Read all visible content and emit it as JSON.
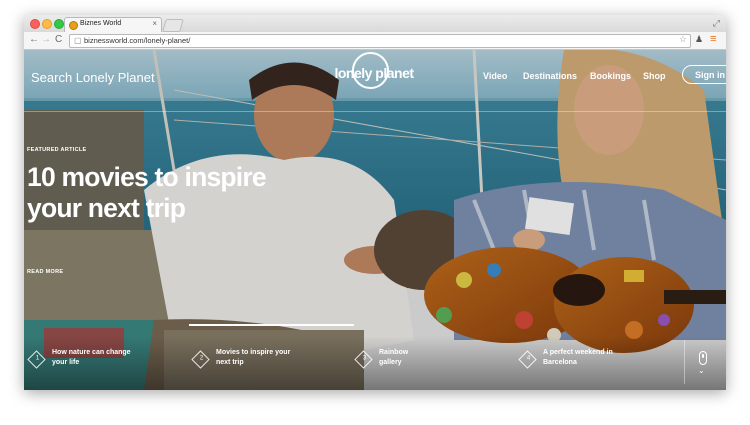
{
  "browser": {
    "tab_title": "Biznes World",
    "tab_close": "×",
    "url": "biznessworld.com/lonely-planet/",
    "back_glyph": "←",
    "forward_glyph": "→",
    "reload_glyph": "C",
    "star_glyph": "☆",
    "menu_glyph": "≡",
    "resize_glyph": "⤢"
  },
  "site": {
    "search_placeholder": "Search Lonely Planet",
    "logo_text": "lonely planet",
    "nav": [
      "Video",
      "Destinations",
      "Bookings",
      "Shop"
    ],
    "signin_label": "Sign in"
  },
  "hero": {
    "kicker": "FEATURED ARTICLE",
    "headline_line1": "10 movies to inspire",
    "headline_line2": "your next trip",
    "read_more": "READ MORE",
    "progress_fraction": 0.25
  },
  "carousel": [
    {
      "num": "1",
      "line1": "How nature can change",
      "line2": "your life"
    },
    {
      "num": "2",
      "line1": "Movies to inspire your",
      "line2": "next trip"
    },
    {
      "num": "3",
      "line1": "Rainbow",
      "line2": "gallery"
    },
    {
      "num": "4",
      "line1": "A perfect weekend in",
      "line2": "Barcelona"
    }
  ],
  "colors": {
    "sea": "#2f7f9b",
    "sky": "#9fc6d6",
    "accent_menu": "#e8731e"
  },
  "icons": [
    "back-arrow-icon",
    "forward-arrow-icon",
    "reload-icon",
    "page-icon",
    "star-icon",
    "extension-icon",
    "menu-icon",
    "scroll-mouse-icon",
    "chevron-down-icon"
  ]
}
